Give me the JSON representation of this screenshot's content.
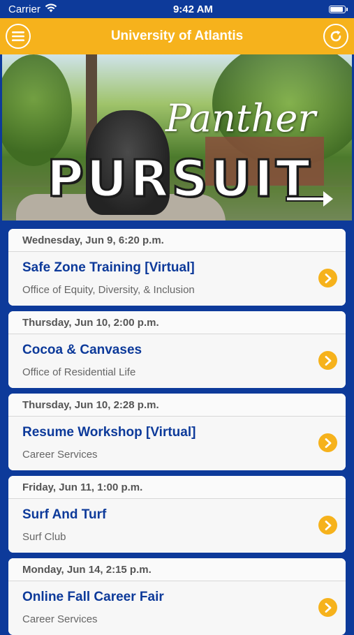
{
  "status_bar": {
    "carrier": "Carrier",
    "time": "9:42 AM",
    "icons": [
      "wifi-icon",
      "battery-icon"
    ]
  },
  "nav": {
    "title": "University of Atlantis",
    "left_icon": "menu-icon",
    "right_icon": "refresh-icon",
    "accent_color": "#f6b21c",
    "brand_color": "#0d3a9a"
  },
  "hero": {
    "line1": "Panther",
    "line2": "PURSUIT"
  },
  "events": [
    {
      "date": "Wednesday, Jun 9, 6:20 p.m.",
      "title": "Safe Zone Training [Virtual]",
      "organizer": "Office of Equity, Diversity, & Inclusion"
    },
    {
      "date": "Thursday, Jun 10, 2:00 p.m.",
      "title": "Cocoa & Canvases",
      "organizer": "Office of Residential Life"
    },
    {
      "date": "Thursday, Jun 10, 2:28 p.m.",
      "title": "Resume Workshop [Virtual]",
      "organizer": "Career Services"
    },
    {
      "date": "Friday, Jun 11, 1:00 p.m.",
      "title": "Surf And Turf",
      "organizer": "Surf Club"
    },
    {
      "date": "Monday, Jun 14, 2:15 p.m.",
      "title": "Online Fall Career Fair",
      "organizer": "Career Services"
    }
  ]
}
